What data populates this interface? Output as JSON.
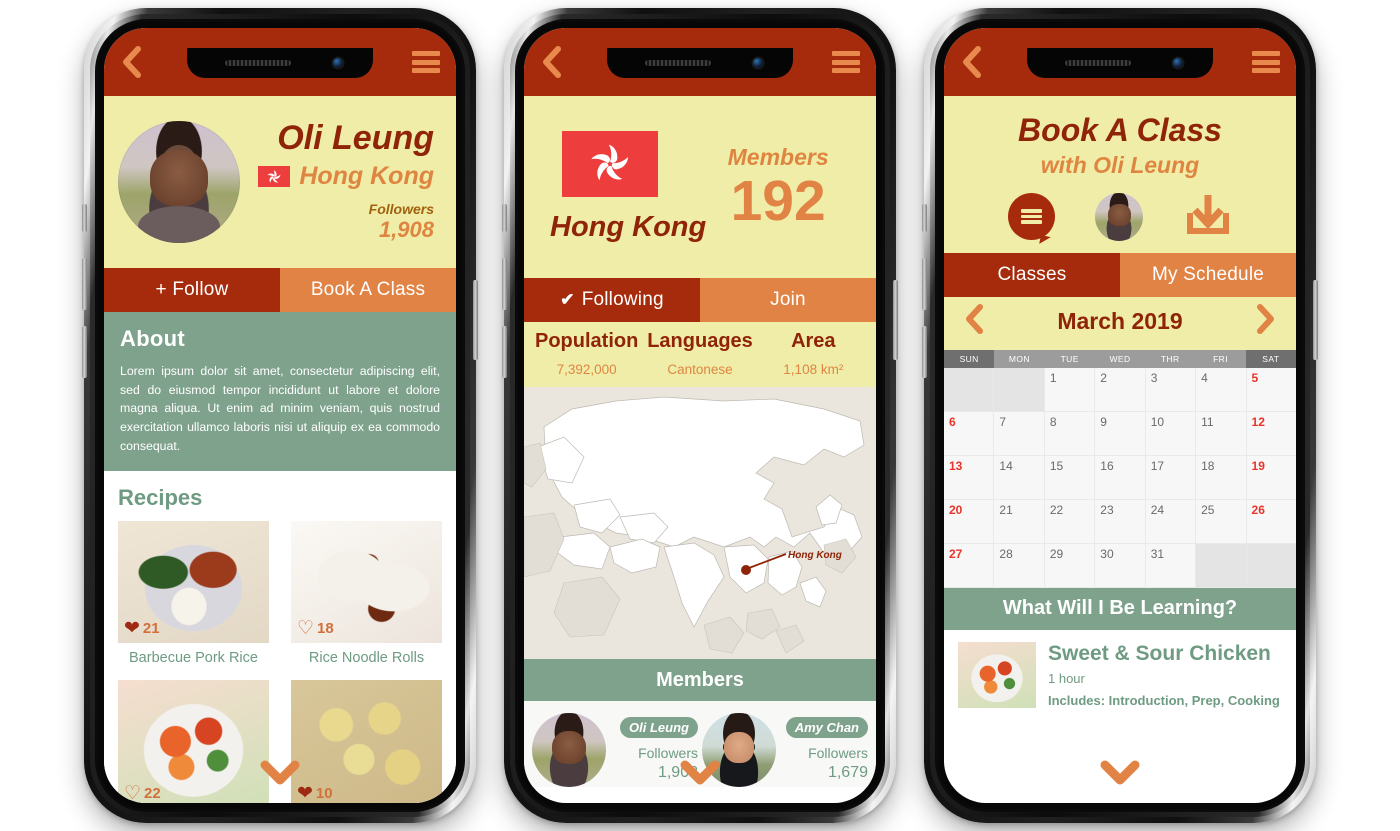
{
  "colors": {
    "brand_dark_red": "#A52B0C",
    "brand_orange": "#E08344",
    "cream": "#F0EDA8",
    "green": "#7FA28C",
    "text_green": "#6E9B82",
    "deep_red": "#8F2408",
    "flag_red": "#EE3D3D"
  },
  "appbar": {
    "back_icon": "chevron-left-icon",
    "menu_icon": "hamburger-menu-icon"
  },
  "phone1": {
    "profile": {
      "name": "Oli Leung",
      "country": "Hong Kong",
      "followers_label": "Followers",
      "followers_count": "1,908"
    },
    "tabs": [
      {
        "label": "+ Follow",
        "active": true
      },
      {
        "label": "Book A Class",
        "active": false
      }
    ],
    "about": {
      "heading": "About",
      "text": "Lorem ipsum dolor sit amet, consectetur adipiscing elit, sed do eiusmod tempor incididunt ut labore et dolore magna aliqua. Ut enim ad minim veniam, quis nostrud exercitation ullamco laboris nisi ut aliquip ex ea commodo consequat."
    },
    "recipes": {
      "heading": "Recipes",
      "items": [
        {
          "name": "Barbecue Pork Rice",
          "likes": "21",
          "liked": true
        },
        {
          "name": "Rice Noodle Rolls",
          "likes": "18",
          "liked": false
        },
        {
          "name": "",
          "likes": "22",
          "liked": false
        },
        {
          "name": "",
          "likes": "10",
          "liked": true
        }
      ]
    },
    "scroll_hint_icon": "chevron-down-icon"
  },
  "phone2": {
    "country": {
      "name": "Hong Kong",
      "flag_icon": "hong-kong-flag-icon",
      "members_label": "Members",
      "members_count": "192"
    },
    "tabs": [
      {
        "label": "Following",
        "active": true,
        "check": "✔"
      },
      {
        "label": "Join",
        "active": false
      }
    ],
    "stats": [
      {
        "key": "Population",
        "value": "7,392,000"
      },
      {
        "key": "Languages",
        "value": "Cantonese"
      },
      {
        "key": "Area",
        "value": "1,108 km²"
      }
    ],
    "map": {
      "pin_label": "Hong Kong"
    },
    "members_heading": "Members",
    "members": [
      {
        "name": "Oli Leung",
        "followers_label": "Followers",
        "followers_count": "1,908"
      },
      {
        "name": "Amy Chan",
        "followers_label": "Followers",
        "followers_count": "1,679"
      }
    ],
    "scroll_hint_icon": "chevron-down-icon"
  },
  "phone3": {
    "title": "Book A Class",
    "subtitle": "with Oli Leung",
    "icons": [
      "chat-menu-icon",
      "instructor-avatar",
      "download-icon"
    ],
    "tabs": [
      {
        "label": "Classes",
        "active": true
      },
      {
        "label": "My Schedule",
        "active": false
      }
    ],
    "calendar": {
      "month": "March 2019",
      "prev_icon": "chevron-left-icon",
      "next_icon": "chevron-right-icon",
      "day_headers": [
        "SUN",
        "MON",
        "TUE",
        "WED",
        "THR",
        "FRI",
        "SAT"
      ],
      "weeks": [
        [
          null,
          null,
          "1",
          "2",
          "3",
          "4",
          "5"
        ],
        [
          "6",
          "7",
          "8",
          "9",
          "10",
          "11",
          "12"
        ],
        [
          "13",
          "14",
          "15",
          "16",
          "17",
          "18",
          "19"
        ],
        [
          "20",
          "21",
          "22",
          "23",
          "24",
          "25",
          "26"
        ],
        [
          "27",
          "28",
          "29",
          "30",
          "31",
          null,
          null
        ]
      ]
    },
    "learning_heading": "What Will I Be Learning?",
    "class": {
      "title": "Sweet & Sour Chicken",
      "duration": "1 hour",
      "includes": "Includes: Introduction, Prep, Cooking"
    },
    "scroll_hint_icon": "chevron-down-icon"
  }
}
